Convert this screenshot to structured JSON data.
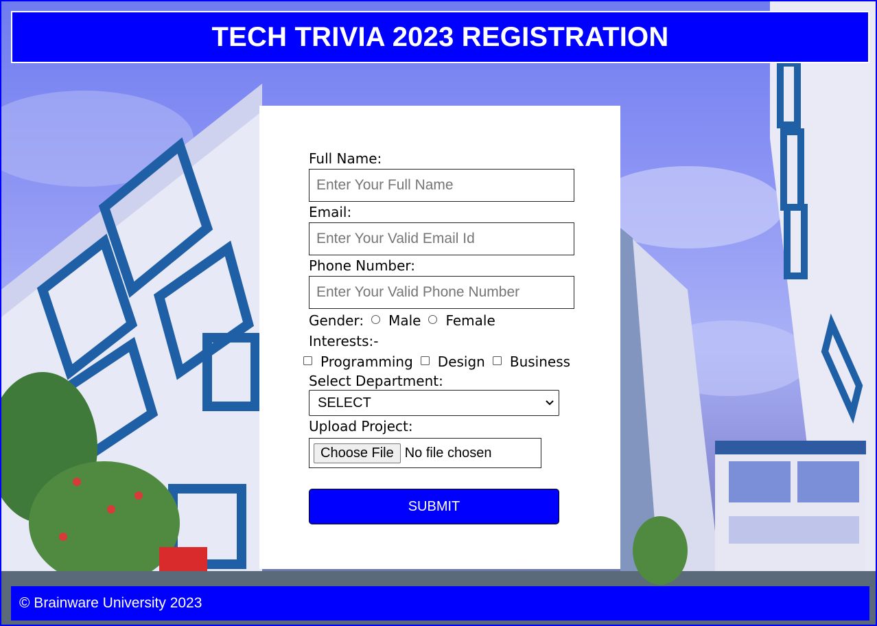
{
  "header": {
    "title": "TECH TRIVIA 2023 REGISTRATION"
  },
  "colors": {
    "accent": "#0000ff",
    "card": "#ffffff"
  },
  "form": {
    "full_name": {
      "label": "Full Name:",
      "value": "",
      "placeholder": "Enter Your Full Name"
    },
    "email": {
      "label": "Email:",
      "value": "",
      "placeholder": "Enter Your Valid Email Id"
    },
    "phone": {
      "label": "Phone Number:",
      "value": "",
      "placeholder": "Enter Your Valid Phone Number"
    },
    "gender": {
      "label": "Gender:",
      "options": [
        "Male",
        "Female"
      ]
    },
    "interests": {
      "label": "Interests:-",
      "options": [
        "Programming",
        "Design",
        "Business"
      ]
    },
    "department": {
      "label": "Select Department:",
      "selected": "SELECT"
    },
    "upload": {
      "label": "Upload Project:",
      "button": "Choose File",
      "status": "No file chosen"
    },
    "submit_label": "SUBMIT"
  },
  "footer": {
    "text": "© Brainware University 2023"
  },
  "background": {
    "description_icon": "campus-building-photo"
  }
}
